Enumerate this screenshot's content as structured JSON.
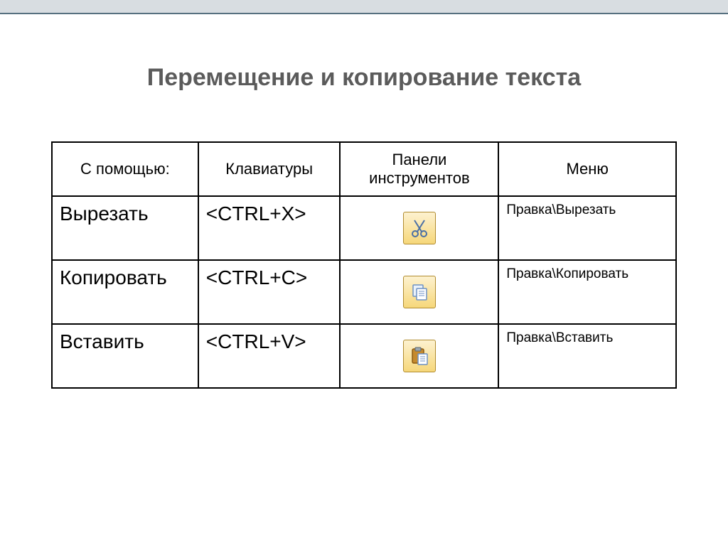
{
  "title": "Перемещение и копирование текста",
  "headers": {
    "using": "С помощью:",
    "keyboard": "Клавиатуры",
    "toolbar": "Панели инструментов",
    "menu": "Меню"
  },
  "rows": [
    {
      "operation": "Вырезать",
      "shortcut": "<CTRL+X>",
      "icon": "cut-icon",
      "menu_path": "Правка\\Вырезать"
    },
    {
      "operation": "Копировать",
      "shortcut": "<CTRL+C>",
      "icon": "copy-icon",
      "menu_path": "Правка\\Копировать"
    },
    {
      "operation": "Вставить",
      "shortcut": "<CTRL+V>",
      "icon": "paste-icon",
      "menu_path": "Правка\\Вставить"
    }
  ]
}
